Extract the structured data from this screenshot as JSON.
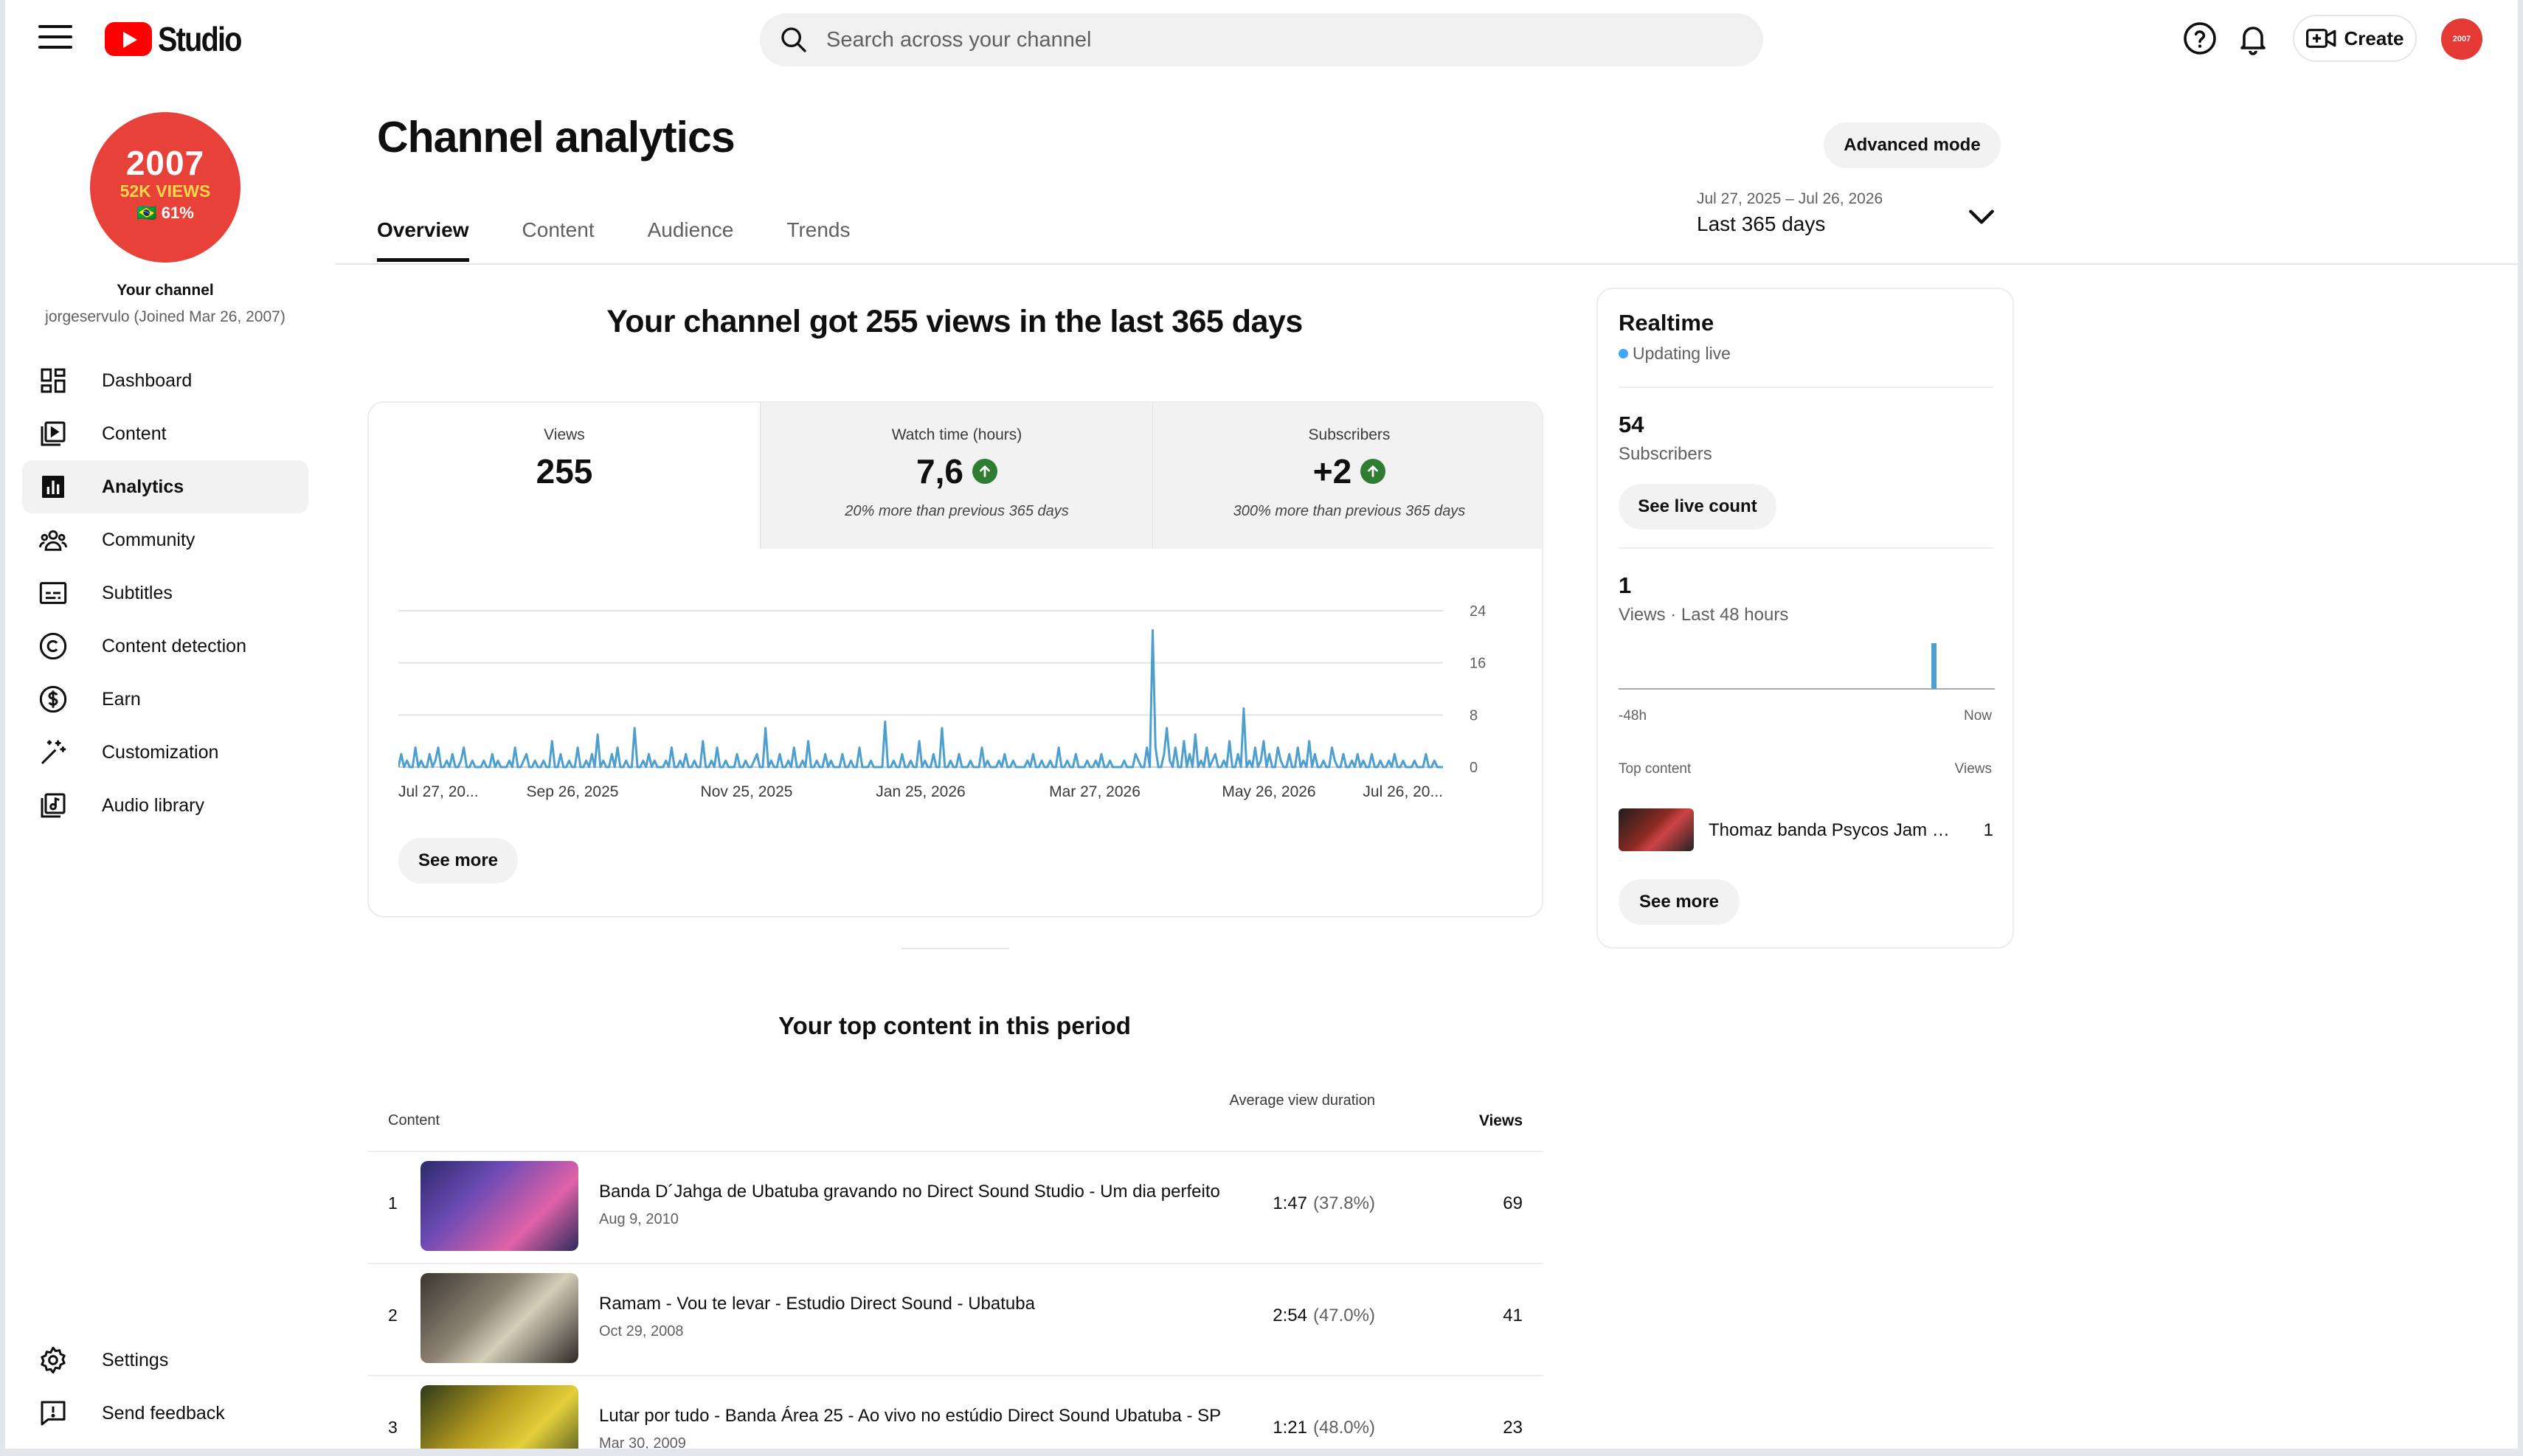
{
  "app": {
    "logo_text": "Studio",
    "search_placeholder": "Search across your channel",
    "create_label": "Create",
    "avatar_text": "2007"
  },
  "channel": {
    "avatar_year": "2007",
    "avatar_views": "52K VIEWS",
    "avatar_pct": "🇧🇷 61%",
    "label": "Your channel",
    "subtitle": "jorgeservulo (Joined Mar 26, 2007)"
  },
  "sidebar": {
    "items": [
      {
        "label": "Dashboard",
        "icon": "dashboard-icon"
      },
      {
        "label": "Content",
        "icon": "content-icon"
      },
      {
        "label": "Analytics",
        "icon": "analytics-icon",
        "active": true
      },
      {
        "label": "Community",
        "icon": "community-icon"
      },
      {
        "label": "Subtitles",
        "icon": "subtitles-icon"
      },
      {
        "label": "Content detection",
        "icon": "copyright-icon"
      },
      {
        "label": "Earn",
        "icon": "dollar-icon"
      },
      {
        "label": "Customization",
        "icon": "magic-wand-icon"
      },
      {
        "label": "Audio library",
        "icon": "audio-library-icon"
      }
    ],
    "bottom": [
      {
        "label": "Settings",
        "icon": "gear-icon"
      },
      {
        "label": "Send feedback",
        "icon": "feedback-icon"
      }
    ]
  },
  "page": {
    "title": "Channel analytics",
    "advanced_mode": "Advanced mode",
    "tabs": [
      "Overview",
      "Content",
      "Audience",
      "Trends"
    ],
    "date_range": "Jul 27, 2025 – Jul 26, 2026",
    "period": "Last 365 days",
    "headline": "Your channel got 255 views in the last 365 days"
  },
  "metrics": [
    {
      "label": "Views",
      "value": "255",
      "comparison": ""
    },
    {
      "label": "Watch time (hours)",
      "value": "7,6",
      "comparison": "20% more than previous 365 days",
      "trend": "up"
    },
    {
      "label": "Subscribers",
      "value": "+2",
      "comparison": "300% more than previous 365 days",
      "trend": "up"
    }
  ],
  "chart_data": {
    "type": "line",
    "x_tick_labels": [
      "Jul 27, 20...",
      "Sep 26, 2025",
      "Nov 25, 2025",
      "Jan 25, 2026",
      "Mar 27, 2026",
      "May 26, 2026",
      "Jul 26, 20..."
    ],
    "y_ticks": [
      0,
      8,
      16,
      24
    ],
    "ylim": [
      0,
      24
    ],
    "series": [
      {
        "values": [
          0,
          2,
          0,
          1,
          0,
          0,
          3,
          0,
          1,
          0,
          0,
          2,
          0,
          1,
          3,
          0,
          0,
          1,
          0,
          2,
          0,
          0,
          1,
          3,
          0,
          0,
          1,
          0,
          0,
          0,
          1,
          0,
          0,
          2,
          0,
          1,
          0,
          0,
          0,
          1,
          0,
          3,
          0,
          0,
          1,
          2,
          0,
          0,
          1,
          0,
          0,
          1,
          0,
          0,
          4,
          0,
          0,
          2,
          0,
          0,
          1,
          0,
          0,
          3,
          0,
          0,
          1,
          0,
          2,
          0,
          5,
          0,
          1,
          0,
          0,
          2,
          0,
          3,
          0,
          0,
          1,
          0,
          0,
          6,
          0,
          0,
          1,
          0,
          2,
          0,
          1,
          0,
          0,
          0,
          1,
          0,
          3,
          0,
          0,
          1,
          0,
          2,
          0,
          0,
          1,
          0,
          0,
          4,
          0,
          0,
          1,
          0,
          3,
          0,
          0,
          1,
          0,
          0,
          0,
          2,
          0,
          0,
          1,
          0,
          0,
          1,
          2,
          0,
          0,
          6,
          0,
          1,
          0,
          0,
          2,
          0,
          0,
          1,
          0,
          3,
          0,
          0,
          1,
          0,
          4,
          0,
          0,
          1,
          0,
          0,
          2,
          0,
          1,
          0,
          0,
          0,
          2,
          0,
          0,
          1,
          0,
          0,
          3,
          0,
          0,
          0,
          1,
          0,
          0,
          0,
          0,
          7,
          0,
          0,
          1,
          0,
          0,
          2,
          0,
          0,
          1,
          0,
          0,
          4,
          0,
          1,
          0,
          0,
          2,
          0,
          0,
          6,
          0,
          0,
          1,
          0,
          0,
          2,
          0,
          0,
          0,
          1,
          0,
          0,
          0,
          3,
          0,
          1,
          0,
          0,
          0,
          1,
          0,
          2,
          0,
          0,
          1,
          0,
          0,
          0,
          0,
          1,
          0,
          2,
          0,
          0,
          1,
          0,
          0,
          1,
          0,
          0,
          3,
          0,
          0,
          1,
          0,
          0,
          2,
          0,
          0,
          0,
          1,
          0,
          0,
          1,
          0,
          2,
          0,
          0,
          1,
          0,
          0,
          0,
          0,
          1,
          0,
          0,
          0,
          2,
          1,
          0,
          0,
          3,
          0,
          21,
          3,
          0,
          0,
          2,
          6,
          1,
          0,
          3,
          0,
          0,
          4,
          0,
          2,
          0,
          5,
          0,
          1,
          0,
          3,
          0,
          1,
          2,
          0,
          0,
          1,
          0,
          4,
          0,
          0,
          2,
          0,
          9,
          0,
          1,
          0,
          3,
          0,
          1,
          4,
          0,
          2,
          0,
          0,
          3,
          1,
          0,
          0,
          2,
          0,
          0,
          3,
          0,
          1,
          0,
          4,
          0,
          2,
          0,
          0,
          1,
          0,
          0,
          3,
          1,
          0,
          0,
          2,
          0,
          0,
          1,
          0,
          2,
          0,
          1,
          0,
          0,
          2,
          0,
          0,
          1,
          0,
          0,
          1,
          0,
          2,
          0,
          0,
          1,
          0,
          0,
          0,
          1,
          0,
          0,
          0,
          2,
          0,
          0,
          1,
          0,
          0,
          0
        ]
      }
    ]
  },
  "actions": {
    "see_more": "See more"
  },
  "top_content": {
    "title": "Your top content in this period",
    "col_content": "Content",
    "col_avd": "Average view duration",
    "col_views": "Views",
    "rows": [
      {
        "rank": "1",
        "title": "Banda D´Jahga de Ubatuba gravando no Direct Sound Studio - Um dia perfeito",
        "date": "Aug 9, 2010",
        "duration": "1:47",
        "pct": "(37.8%)",
        "views": "69",
        "thumb": "#c04e8e"
      },
      {
        "rank": "2",
        "title": "Ramam - Vou te levar - Estudio Direct Sound - Ubatuba",
        "date": "Oct 29, 2008",
        "duration": "2:54",
        "pct": "(47.0%)",
        "views": "41",
        "thumb": "#8a7f6a"
      },
      {
        "rank": "3",
        "title": "Lutar por tudo - Banda Área 25 - Ao vivo no estúdio Direct Sound Ubatuba - SP",
        "date": "Mar 30, 2009",
        "duration": "1:21",
        "pct": "(48.0%)",
        "views": "23",
        "thumb": "#c8b21c"
      }
    ]
  },
  "realtime": {
    "title": "Realtime",
    "status": "Updating live",
    "subs_value": "54",
    "subs_label": "Subscribers",
    "live_count_btn": "See live count",
    "views_value": "1",
    "views_label": "Views · Last 48 hours",
    "axis_start": "-48h",
    "axis_end": "Now",
    "top_content_label": "Top content",
    "views_col": "Views",
    "top_item_title": "Thomaz banda Psycos Jam session",
    "top_item_views": "1",
    "see_more": "See more"
  }
}
